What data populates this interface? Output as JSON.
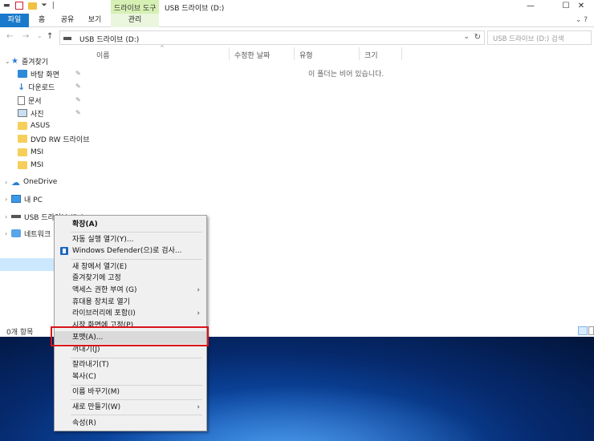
{
  "window": {
    "title": "USB 드라이브 (D:)",
    "context_tab_header": "드라이브 도구",
    "controls": {
      "minimize": "—",
      "maximize": "☐",
      "close": "✕"
    }
  },
  "ribbon": {
    "tabs": [
      "파일",
      "홈",
      "공유",
      "보기",
      "관리"
    ],
    "expand": "⌄ ?"
  },
  "address": {
    "path": "USB 드라이브 (D:)",
    "search_placeholder": "USB 드라이브 (D:) 검색",
    "back": "←",
    "forward": "→",
    "recent": "⌄",
    "up": "↑",
    "dropdown": "⌄",
    "refresh": "↻"
  },
  "nav": {
    "quick_access": "즐겨찾기",
    "items": [
      {
        "label": "바탕 화면",
        "icon": "desktop-icon",
        "pinned": true
      },
      {
        "label": "다운로드",
        "icon": "download-icon",
        "pinned": true
      },
      {
        "label": "문서",
        "icon": "document-icon",
        "pinned": true
      },
      {
        "label": "사진",
        "icon": "pictures-icon",
        "pinned": true
      },
      {
        "label": "ASUS",
        "icon": "folder-icon",
        "pinned": false
      },
      {
        "label": "DVD RW 드라이브",
        "icon": "folder-icon",
        "pinned": false
      },
      {
        "label": "MSI",
        "icon": "folder-icon",
        "pinned": false
      },
      {
        "label": "MSI",
        "icon": "folder-icon",
        "pinned": false
      }
    ],
    "onedrive": "OneDrive",
    "this_pc": "내 PC",
    "usb": "USB 드라이브 (D:)",
    "network": "네트워크"
  },
  "content": {
    "columns": [
      "이름",
      "수정한 날짜",
      "유형",
      "크기"
    ],
    "empty_message": "이 폴더는 비어 있습니다."
  },
  "status": {
    "item_count": "0개 항목"
  },
  "context_menu": {
    "items": [
      {
        "label": "확장(A)",
        "bold": true
      },
      {
        "label": "자동 실행 열기(Y)..."
      },
      {
        "label": "Windows Defender(으)로 검사...",
        "icon": "defender-icon"
      },
      {
        "label": "새 창에서 열기(E)"
      },
      {
        "label": "즐겨찾기에 고정"
      },
      {
        "label": "액세스 권한 부여 (G)",
        "submenu": true
      },
      {
        "label": "휴대용 장치로 열기"
      },
      {
        "label": "라이브러리에 포함(I)",
        "submenu": true
      },
      {
        "label": "시작 화면에 고정(P)"
      },
      {
        "label": "포맷(A)...",
        "highlighted": true
      },
      {
        "label": "꺼내기(J)"
      },
      {
        "label": "잘라내기(T)"
      },
      {
        "label": "복사(C)"
      },
      {
        "label": "이름 바꾸기(M)"
      },
      {
        "label": "새로 만들기(W)",
        "submenu": true
      },
      {
        "label": "속성(R)"
      }
    ]
  },
  "colors": {
    "file_tab": "#1979ca",
    "context_tab": "#d6f0b4",
    "highlight_box": "#d8141b"
  }
}
